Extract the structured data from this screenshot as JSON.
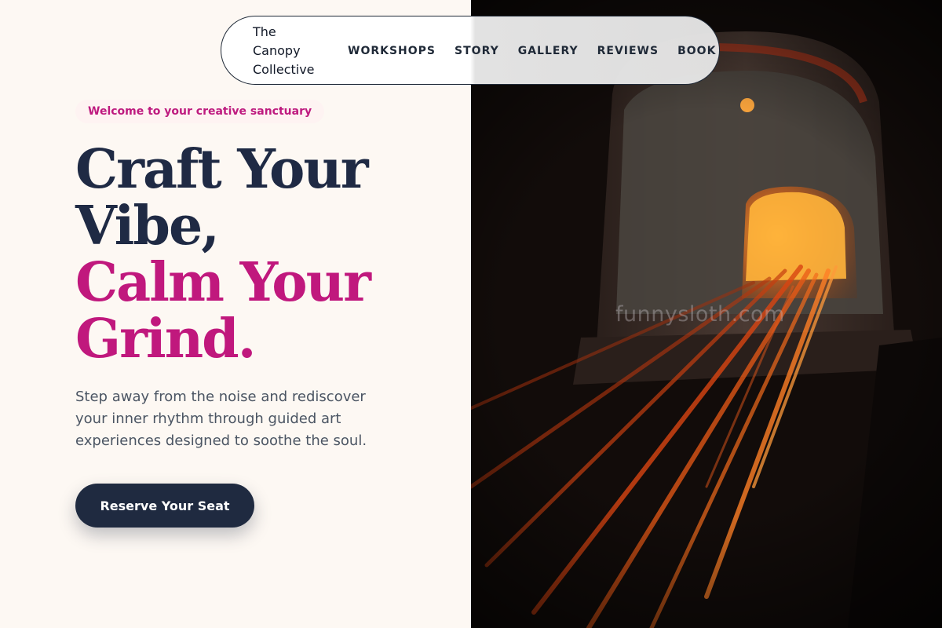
{
  "brand": {
    "name_line1": "The",
    "name_line2": "Canopy",
    "name_line3": "Collective"
  },
  "nav": {
    "items": [
      {
        "label": "WORKSHOPS"
      },
      {
        "label": "STORY"
      },
      {
        "label": "GALLERY"
      },
      {
        "label": "REVIEWS"
      },
      {
        "label": "BOOK"
      }
    ]
  },
  "hero": {
    "tag": "Welcome to your creative sanctuary",
    "headline_line1": "Craft Your",
    "headline_line2": "Vibe,",
    "headline_line3": "Calm Your",
    "headline_line4": "Grind.",
    "lede": "Step away from the noise and rediscover your inner rhythm through guided art experiences designed to soothe the soul.",
    "cta_label": "Reserve Your Seat"
  },
  "image": {
    "watermark": "funnysloth.com"
  },
  "colors": {
    "background": "#fdf8f3",
    "navy": "#1f2a44",
    "accent_pink": "#c0187d",
    "body_text": "#4b5563"
  }
}
